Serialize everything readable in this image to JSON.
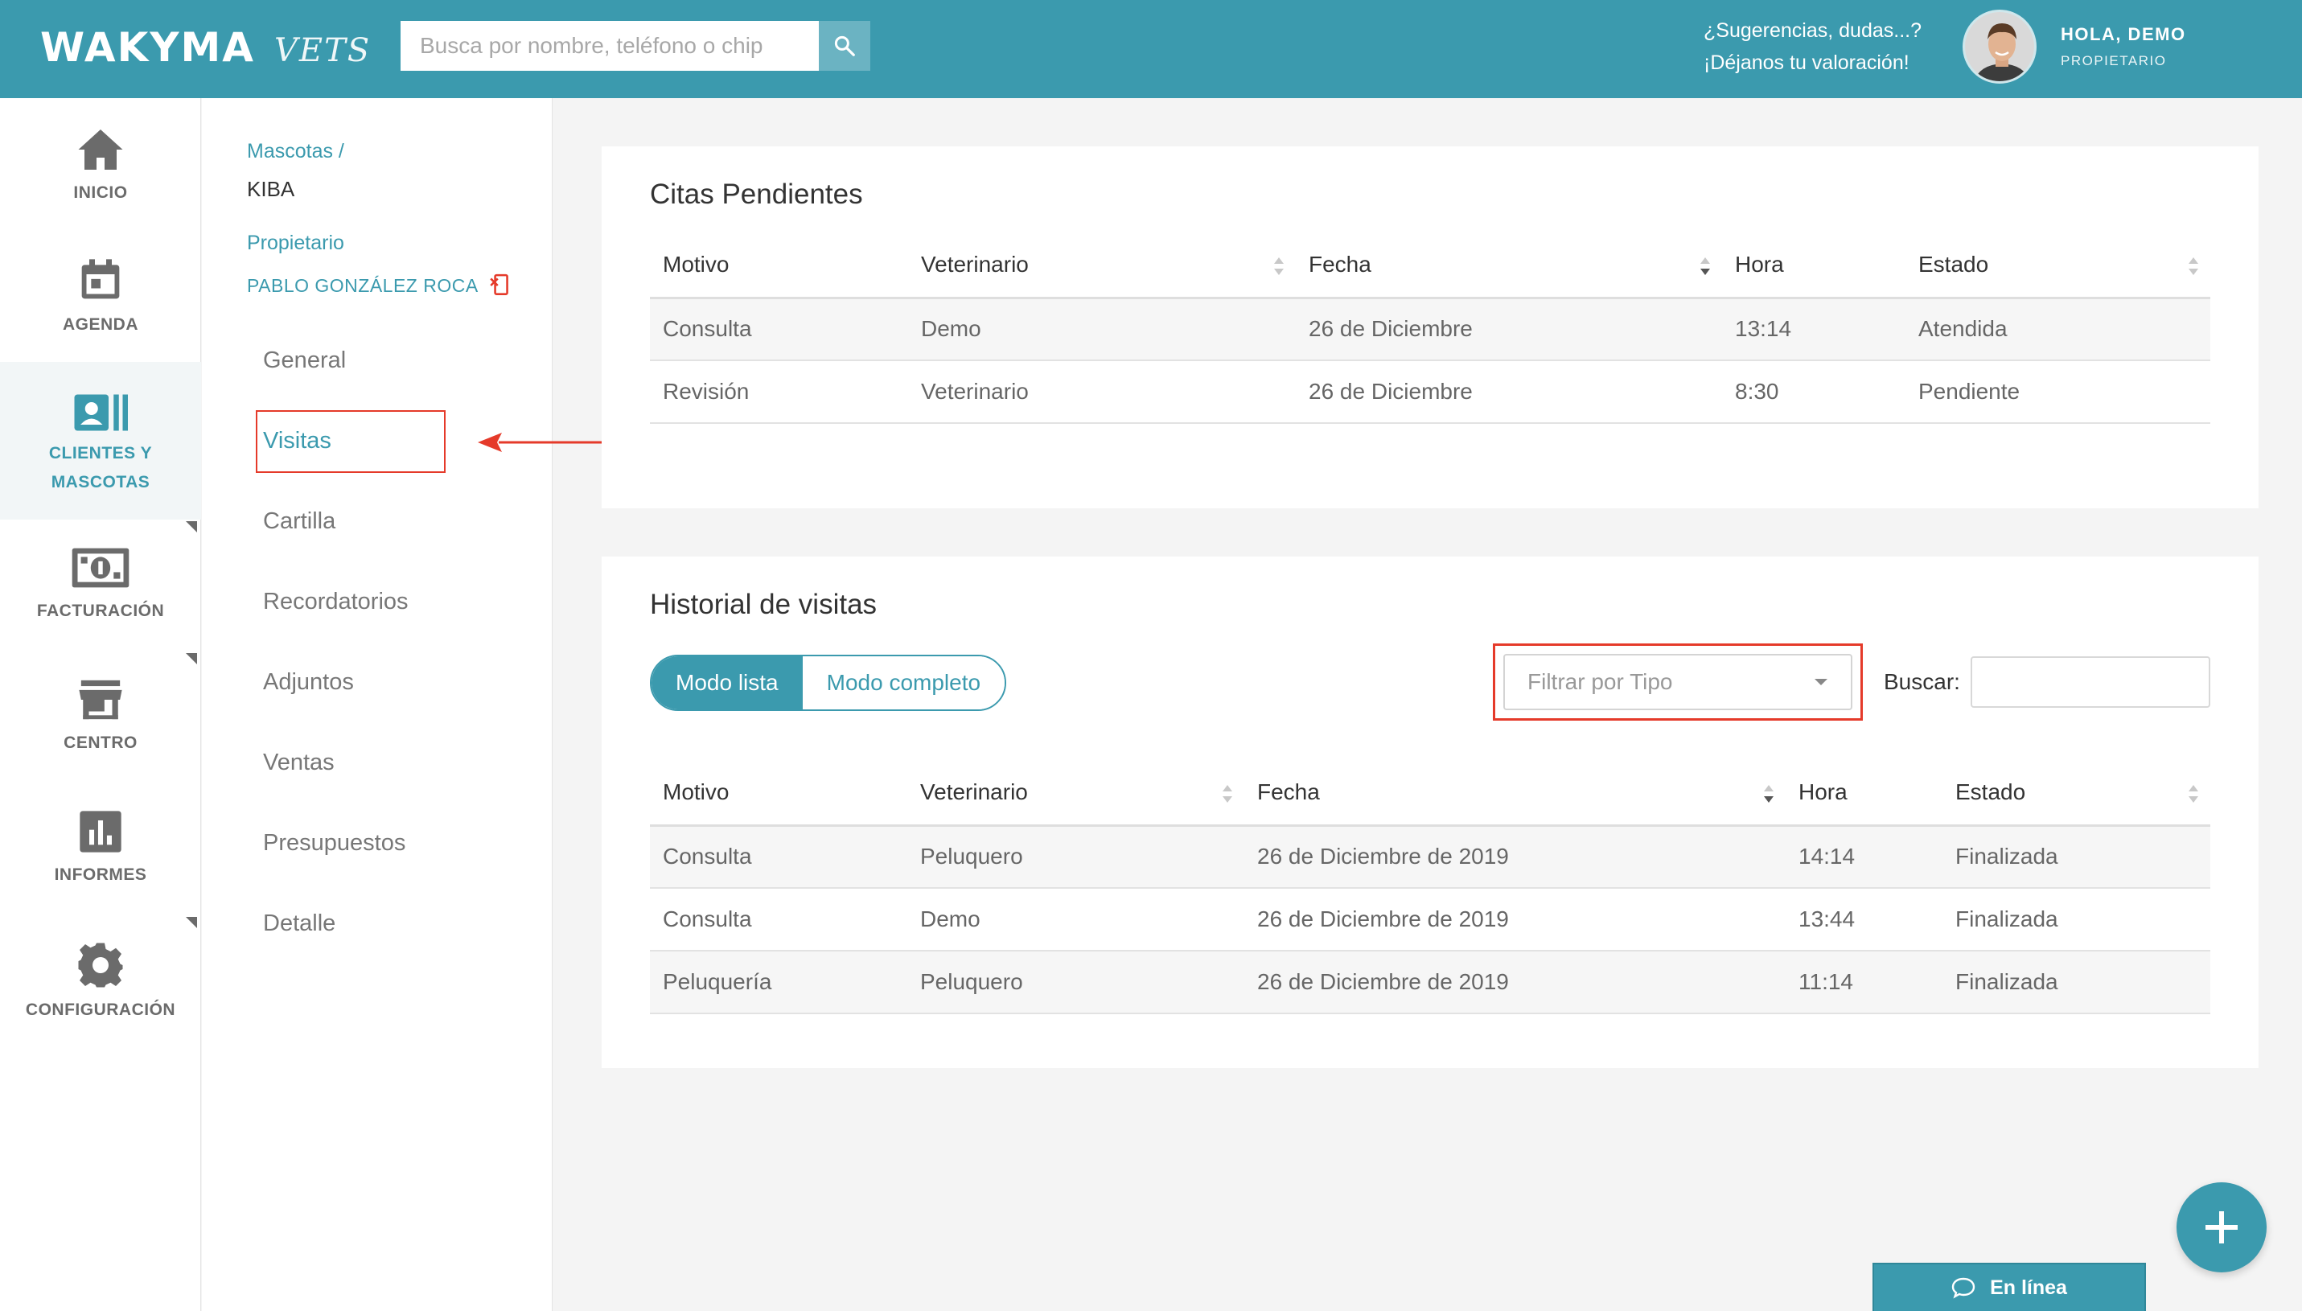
{
  "header": {
    "logo_main": "WAKYMA",
    "logo_sub": "VETS",
    "search_placeholder": "Busca por nombre, teléfono o chip",
    "suggest_line1": "¿Sugerencias, dudas...?",
    "suggest_line2": "¡Déjanos tu valoración!",
    "greeting": "HOLA, DEMO",
    "role": "PROPIETARIO"
  },
  "nav": {
    "items": [
      {
        "label": "INICIO",
        "icon": "home-icon"
      },
      {
        "label": "AGENDA",
        "icon": "calendar-icon"
      },
      {
        "label_line1": "CLIENTES Y",
        "label_line2": "MASCOTAS",
        "icon": "contacts-icon",
        "active": true
      },
      {
        "label": "FACTURACIÓN",
        "icon": "money-icon"
      },
      {
        "label": "CENTRO",
        "icon": "store-icon"
      },
      {
        "label": "INFORMES",
        "icon": "chart-icon"
      },
      {
        "label": "CONFIGURACIÓN",
        "icon": "gear-icon"
      }
    ]
  },
  "pet": {
    "breadcrumb": "Mascotas /",
    "name": "KIBA",
    "owner_label": "Propietario",
    "owner_name": "PABLO GONZÁLEZ ROCA"
  },
  "subnav": {
    "items": [
      "General",
      "Visitas",
      "Cartilla",
      "Recordatorios",
      "Adjuntos",
      "Ventas",
      "Presupuestos",
      "Detalle"
    ],
    "selected": "Visitas"
  },
  "pending": {
    "title": "Citas Pendientes",
    "columns": [
      "Motivo",
      "Veterinario",
      "Fecha",
      "Hora",
      "Estado"
    ],
    "rows": [
      [
        "Consulta",
        "Demo",
        "26 de Diciembre",
        "13:14",
        "Atendida"
      ],
      [
        "Revisión",
        "Veterinario",
        "26 de Diciembre",
        "8:30",
        "Pendiente"
      ]
    ]
  },
  "history": {
    "title": "Historial de visitas",
    "mode_list": "Modo lista",
    "mode_full": "Modo completo",
    "filter_placeholder": "Filtrar por Tipo",
    "search_label": "Buscar:",
    "columns": [
      "Motivo",
      "Veterinario",
      "Fecha",
      "Hora",
      "Estado"
    ],
    "rows": [
      [
        "Consulta",
        "Peluquero",
        "26 de Diciembre de 2019",
        "14:14",
        "Finalizada"
      ],
      [
        "Consulta",
        "Demo",
        "26 de Diciembre de 2019",
        "13:44",
        "Finalizada"
      ],
      [
        "Peluquería",
        "Peluquero",
        "26 de Diciembre de 2019",
        "11:14",
        "Finalizada"
      ]
    ]
  },
  "chat": {
    "label": "En línea"
  },
  "colors": {
    "brand": "#3b9aae",
    "highlight": "#e53a2a"
  }
}
